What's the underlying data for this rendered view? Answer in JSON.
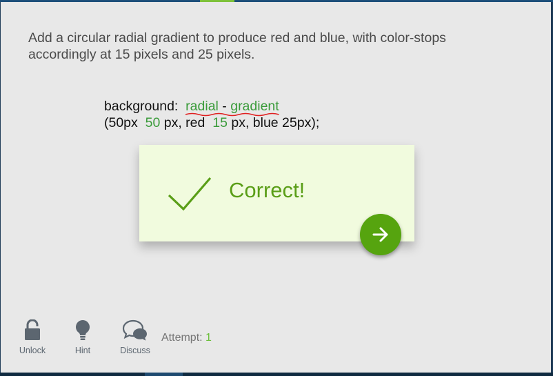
{
  "question": {
    "line1": "Add a circular radial gradient to produce red and blue, with color-stops",
    "line2": "accordingly at 15 pixels and 25 pixels."
  },
  "code": {
    "prefix": "background:",
    "r_letter": "r",
    "radial": "adial",
    "dash": "-",
    "gradient": "gradient",
    "line2_a": "(50px",
    "blank1": "50",
    "line2_b": "px, red",
    "blank2": "15",
    "line2_c": "px, blue 25px);"
  },
  "feedback": {
    "message": "Correct!",
    "accent_color": "#5a9e17",
    "card_color": "#f1fbde"
  },
  "toolbar": {
    "unlock_label": "Unlock",
    "hint_label": "Hint",
    "discuss_label": "Discuss",
    "attempt_label": "Attempt:",
    "attempt_count": "1"
  },
  "icons": {
    "check": "check-icon",
    "next": "arrow-right-icon",
    "unlock": "lock-icon",
    "hint": "lightbulb-icon",
    "discuss": "chat-bubbles-icon"
  }
}
